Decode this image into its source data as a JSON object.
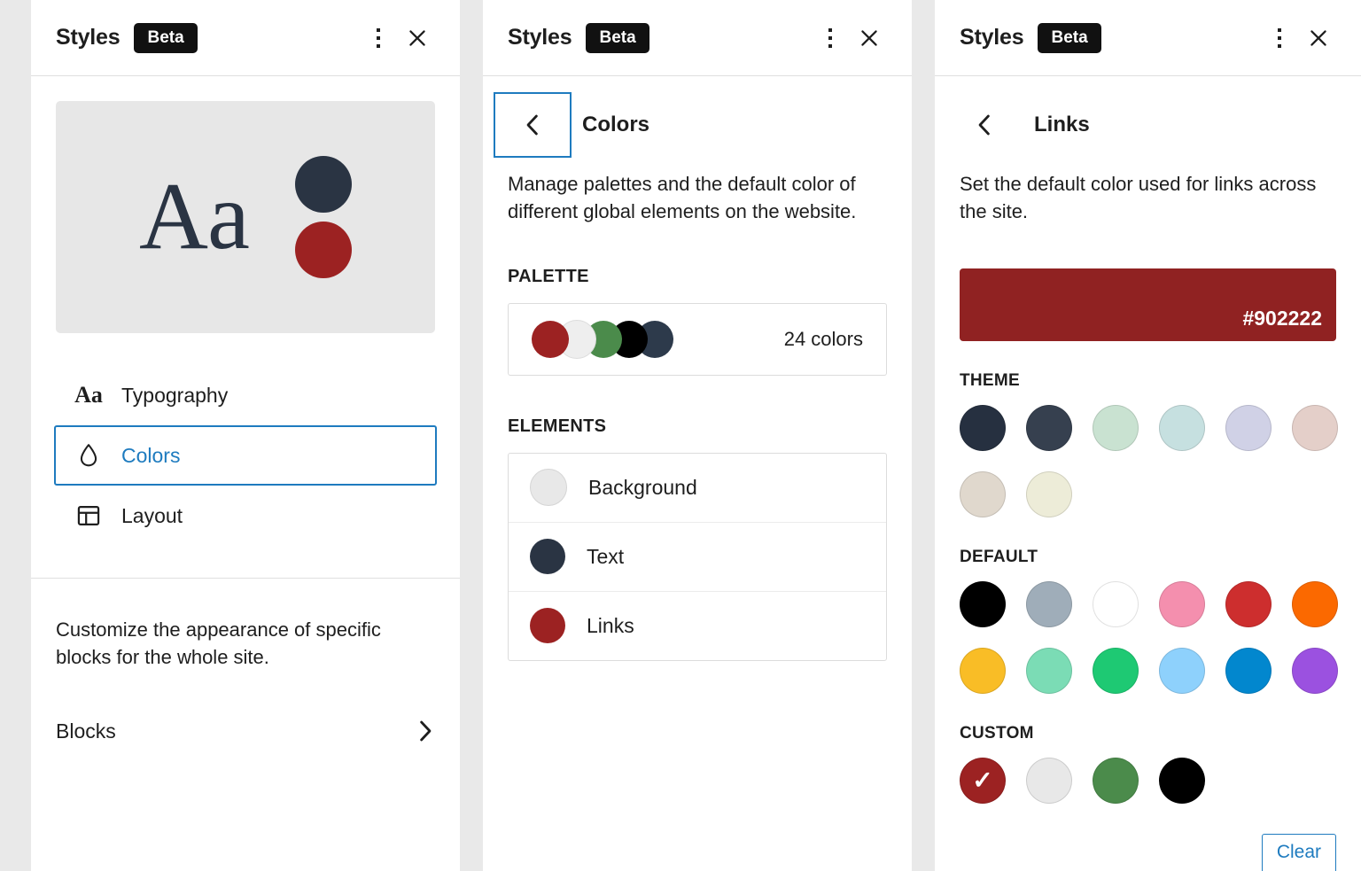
{
  "header": {
    "title": "Styles",
    "badge": "Beta",
    "menu_icon": "kebab-menu-icon",
    "close_icon": "close-icon"
  },
  "panel_styles": {
    "preview": {
      "sample_text": "Aa",
      "text_color": "#2a3443",
      "dot_top_color": "#2a3443",
      "dot_bottom_color": "#9c2222",
      "background": "#e7e7e7"
    },
    "nav_items": [
      {
        "label": "Typography",
        "icon": "typography-aa-icon",
        "selected": false
      },
      {
        "label": "Colors",
        "icon": "droplet-icon",
        "selected": true
      },
      {
        "label": "Layout",
        "icon": "layout-grid-icon",
        "selected": false
      }
    ],
    "blocks": {
      "description": "Customize the appearance of specific blocks for the whole site.",
      "label": "Blocks",
      "chevron_icon": "chevron-right-icon"
    }
  },
  "panel_colors": {
    "back_icon": "chevron-left-icon",
    "title": "Colors",
    "description": "Manage palettes and the default color of different global elements on the website.",
    "palette_label": "PALETTE",
    "palette_swatches": [
      "#9c2222",
      "#eeeeee",
      "#4b8b4b",
      "#000000",
      "#2d3a4b"
    ],
    "palette_count": "24 colors",
    "elements_label": "ELEMENTS",
    "elements": [
      {
        "label": "Background",
        "color": "#e8e8e8"
      },
      {
        "label": "Text",
        "color": "#2a3443"
      },
      {
        "label": "Links",
        "color": "#9c2222"
      }
    ]
  },
  "panel_links": {
    "back_icon": "chevron-left-icon",
    "title": "Links",
    "description": "Set the default color used for links across the site.",
    "current_color": "#902222",
    "current_color_label": "#902222",
    "sections": [
      {
        "label": "THEME",
        "swatches": [
          {
            "color": "#263040",
            "selected": false
          },
          {
            "color": "#36404f",
            "selected": false
          },
          {
            "color": "#c9e2d1",
            "selected": false
          },
          {
            "color": "#c6e0e0",
            "selected": false
          },
          {
            "color": "#d0d1e6",
            "selected": false
          },
          {
            "color": "#e4cfc9",
            "selected": false
          },
          {
            "color": "#e0d8cd",
            "selected": false
          },
          {
            "color": "#edecd8",
            "selected": false
          }
        ]
      },
      {
        "label": "DEFAULT",
        "swatches": [
          {
            "color": "#000000",
            "selected": false
          },
          {
            "color": "#9fadb9",
            "selected": false
          },
          {
            "color": "#ffffff",
            "selected": false
          },
          {
            "color": "#f48fae",
            "selected": false
          },
          {
            "color": "#cd2e2e",
            "selected": false
          },
          {
            "color": "#fb6900",
            "selected": false
          },
          {
            "color": "#f9bd26",
            "selected": false
          },
          {
            "color": "#7bdcb5",
            "selected": false
          },
          {
            "color": "#1ec973",
            "selected": false
          },
          {
            "color": "#8ed1fc",
            "selected": false
          },
          {
            "color": "#0287ce",
            "selected": false
          },
          {
            "color": "#9b51e0",
            "selected": false
          }
        ]
      },
      {
        "label": "CUSTOM",
        "swatches": [
          {
            "color": "#9c2222",
            "selected": true
          },
          {
            "color": "#e8e8e8",
            "selected": false
          },
          {
            "color": "#4b8b4b",
            "selected": false
          },
          {
            "color": "#000000",
            "selected": false
          }
        ]
      }
    ],
    "clear_label": "Clear",
    "check_glyph": "✓"
  }
}
